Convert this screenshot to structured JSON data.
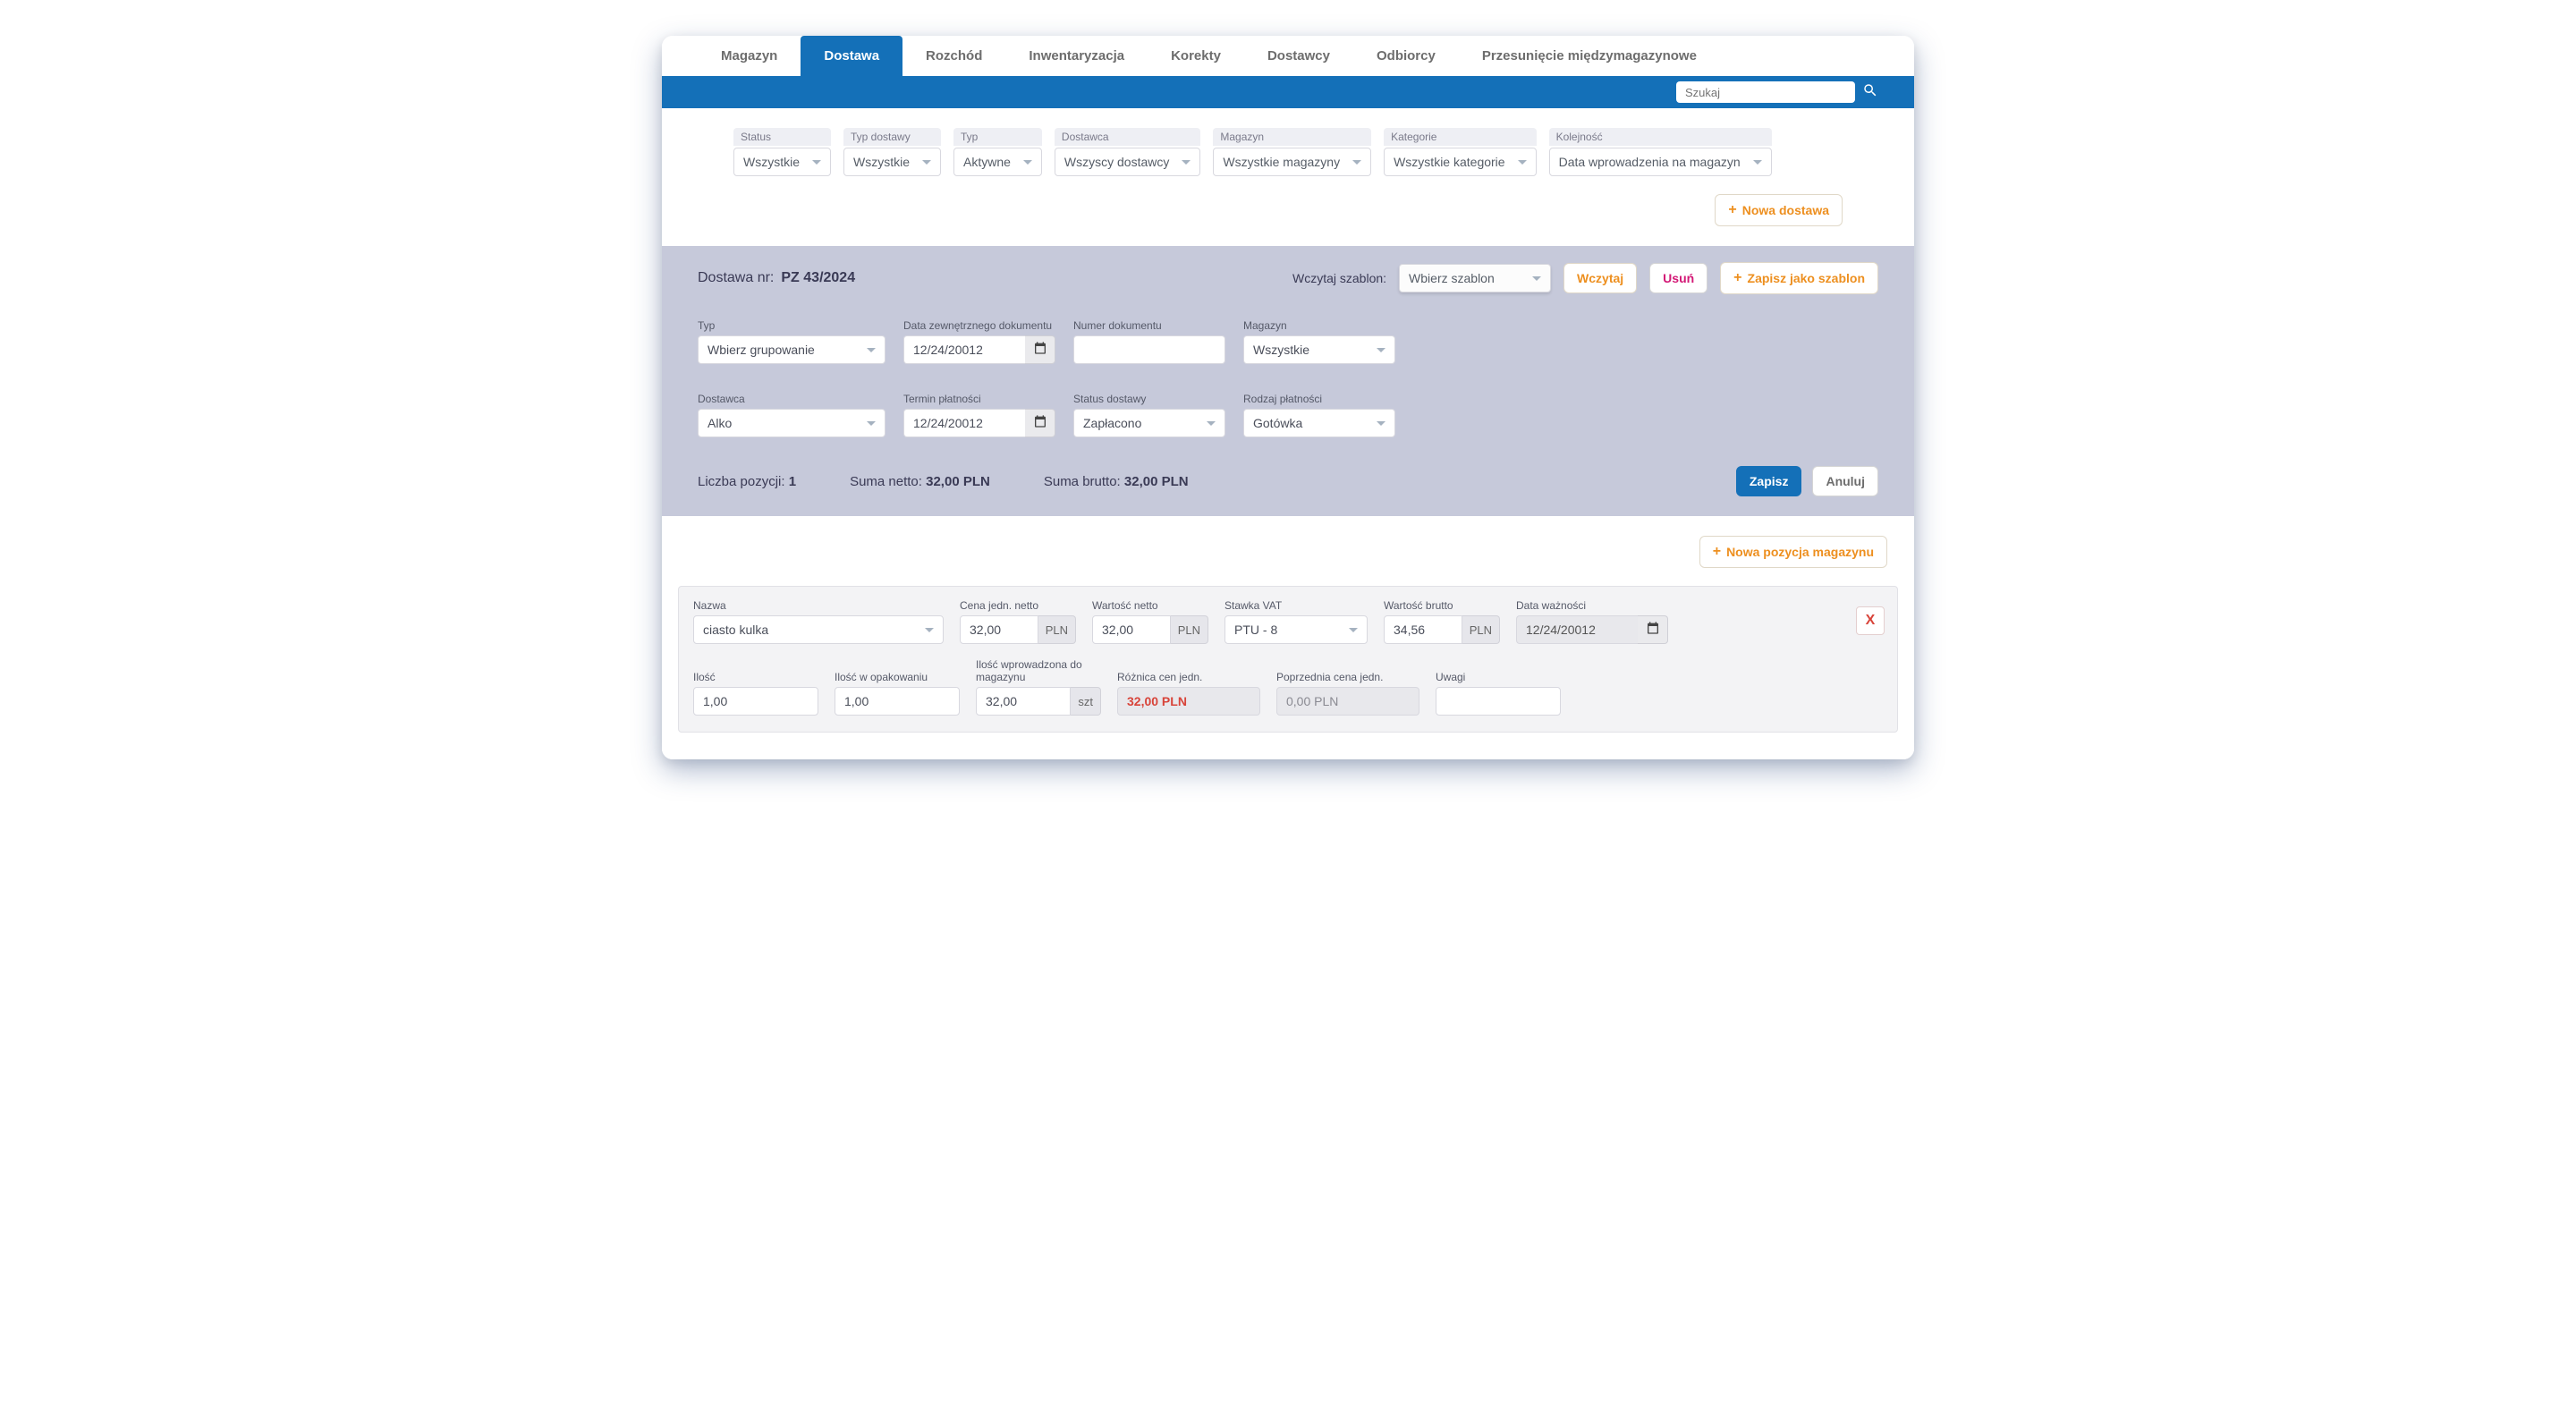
{
  "tabs": [
    {
      "label": "Magazyn"
    },
    {
      "label": "Dostawa"
    },
    {
      "label": "Rozchód"
    },
    {
      "label": "Inwentaryzacja"
    },
    {
      "label": "Korekty"
    },
    {
      "label": "Dostawcy"
    },
    {
      "label": "Odbiorcy"
    },
    {
      "label": "Przesunięcie międzymagazynowe"
    }
  ],
  "search": {
    "placeholder": "Szukaj"
  },
  "filters": {
    "status": {
      "label": "Status",
      "value": "Wszystkie"
    },
    "typ_dostawy": {
      "label": "Typ dostawy",
      "value": "Wszystkie"
    },
    "typ": {
      "label": "Typ",
      "value": "Aktywne"
    },
    "dostawca": {
      "label": "Dostawca",
      "value": "Wszyscy dostawcy"
    },
    "magazyn": {
      "label": "Magazyn",
      "value": "Wszystkie magazyny"
    },
    "kategorie": {
      "label": "Kategorie",
      "value": "Wszystkie kategorie"
    },
    "kolejnosc": {
      "label": "Kolejność",
      "value": "Data wprowadzenia na magazyn"
    }
  },
  "buttons": {
    "nowa_dostawa": "Nowa dostawa",
    "wczytaj": "Wczytaj",
    "usun": "Usuń",
    "zapisz_szablon": "Zapisz jako szablon",
    "zapisz": "Zapisz",
    "anuluj": "Anuluj",
    "nowa_pozycja": "Nowa pozycja magazynu"
  },
  "doc": {
    "title_prefix": "Dostawa nr:",
    "number": "PZ 43/2024",
    "template_label": "Wczytaj szablon:",
    "template_value": "Wbierz szablon"
  },
  "form": {
    "typ": {
      "label": "Typ",
      "value": "Wbierz grupowanie"
    },
    "data_zewn": {
      "label": "Data zewnętrznego dokumentu",
      "value": "12/24/20012"
    },
    "numer_dok": {
      "label": "Numer dokumentu",
      "value": ""
    },
    "magazyn": {
      "label": "Magazyn",
      "value": "Wszystkie"
    },
    "dostawca": {
      "label": "Dostawca",
      "value": "Alko"
    },
    "termin": {
      "label": "Termin płatności",
      "value": "12/24/20012"
    },
    "status": {
      "label": "Status dostawy",
      "value": "Zapłacono"
    },
    "rodzaj": {
      "label": "Rodzaj płatności",
      "value": "Gotówka"
    }
  },
  "summary": {
    "liczba_label": "Liczba pozycji:",
    "liczba_value": "1",
    "netto_label": "Suma netto:",
    "netto_value": "32,00 PLN",
    "brutto_label": "Suma brutto:",
    "brutto_value": "32,00 PLN"
  },
  "item": {
    "nazwa": {
      "label": "Nazwa",
      "value": "ciasto kulka"
    },
    "cena_netto": {
      "label": "Cena jedn. netto",
      "value": "32,00",
      "unit": "PLN"
    },
    "wartosc_netto": {
      "label": "Wartość netto",
      "value": "32,00",
      "unit": "PLN"
    },
    "vat": {
      "label": "Stawka VAT",
      "value": "PTU - 8"
    },
    "wartosc_brutto": {
      "label": "Wartość brutto",
      "value": "34,56",
      "unit": "PLN"
    },
    "data_waznosci": {
      "label": "Data ważności",
      "value": "12/24/20012"
    },
    "ilosc": {
      "label": "Ilość",
      "value": "1,00"
    },
    "ilosc_opak": {
      "label": "Ilość w opakowaniu",
      "value": "1,00"
    },
    "ilosc_mag": {
      "label": "Ilość wprowadzona do magazynu",
      "value": "32,00",
      "unit": "szt"
    },
    "roznica": {
      "label": "Różnica cen jedn.",
      "value": "32,00 PLN"
    },
    "poprzednia": {
      "label": "Poprzednia cena jedn.",
      "value": "0,00 PLN"
    },
    "uwagi": {
      "label": "Uwagi",
      "value": ""
    },
    "delete": "X"
  }
}
